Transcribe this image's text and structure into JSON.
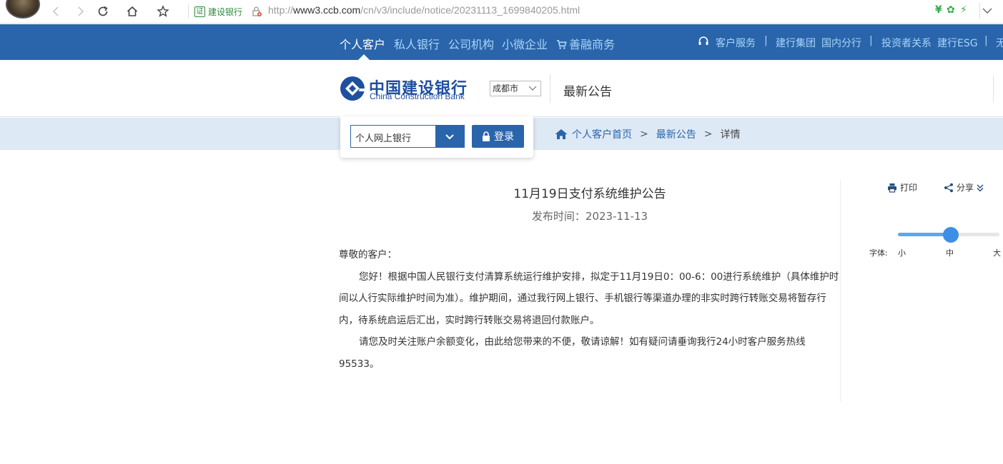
{
  "browser": {
    "url_prefix": "http://",
    "url_host": "www3.ccb.com",
    "url_path": "/cn/v3/include/notice/20231113_1699840205.html",
    "cert_badge": "证",
    "cert_label": "建设银行",
    "ext_icons": [
      "yen-icon",
      "gear-icon",
      "bolt-icon"
    ],
    "ext_glyphs": [
      "¥",
      "✿",
      "⚡"
    ],
    "colors": {
      "ext_green": "#2eb04a"
    }
  },
  "topnav": {
    "items": [
      "个人客户",
      "私人银行",
      "公司机构",
      "小微企业",
      "善融商务"
    ],
    "active_index": 0,
    "right": {
      "service": "客户服务",
      "group": "建行集团",
      "domestic": "国内分行",
      "investor": "投资者关系",
      "esg": "建行ESG",
      "more": "无"
    },
    "colors": {
      "bg": "#2a65ab",
      "link": "#a9d4f7"
    }
  },
  "header": {
    "logo_cn": "中国建设银行",
    "logo_en": "China Construction Bank",
    "city": "成都市",
    "title": "最新公告"
  },
  "login": {
    "bank_select": "个人网上银行",
    "login_label": "登录"
  },
  "breadcrumb": {
    "home": "个人客户首页",
    "section": "最新公告",
    "current": "详情",
    "separator": ">"
  },
  "article": {
    "title": "11月19日支付系统维护公告",
    "date_label": "发布时间：",
    "date": "2023-11-13",
    "greeting": "尊敬的客户：",
    "paragraph1": "您好！根据中国人民银行支付清算系统运行维护安排，拟定于11月19日0：00-6：00进行系统维护（具体维护时间以人行实际维护时间为准）。维护期间，通过我行网上银行、手机银行等渠道办理的非实时跨行转账交易将暂存行内，待系统启运后汇出，实时跨行转账交易将退回付款账户。",
    "paragraph2": "请您及时关注账户余额变化，由此给您带来的不便，敬请谅解！如有疑问请垂询我行24小时客户服务热线95533。"
  },
  "tools": {
    "print": "打印",
    "share": "分享",
    "font_label": "字体:",
    "font_sizes": [
      "小",
      "中",
      "大"
    ],
    "font_level": "中"
  }
}
